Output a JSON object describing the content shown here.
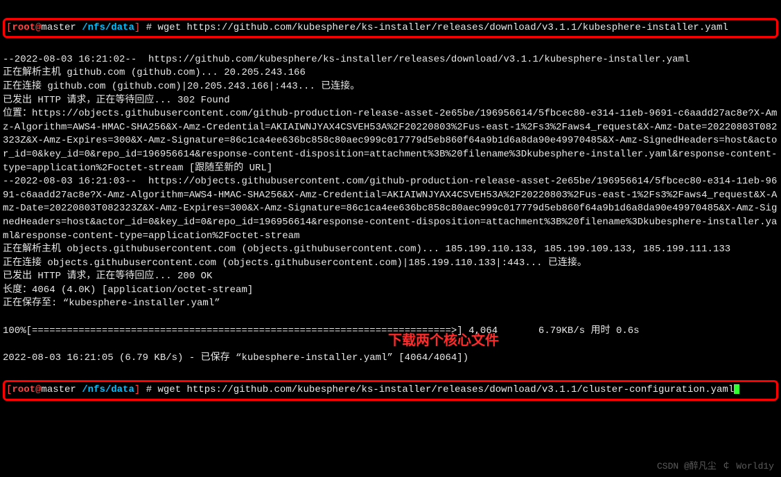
{
  "prompt1": {
    "user": "root",
    "at": "@",
    "host": "master",
    "path": "/nfs/data",
    "hash": "#",
    "command": "wget https://github.com/kubesphere/ks-installer/releases/download/v3.1.1/kubesphere-installer.yaml"
  },
  "output": {
    "l1": "--2022-08-03 16:21:02--  https://github.com/kubesphere/ks-installer/releases/download/v3.1.1/kubesphere-installer.yaml",
    "l2": "正在解析主机 github.com (github.com)... 20.205.243.166",
    "l3": "正在连接 github.com (github.com)|20.205.243.166|:443... 已连接。",
    "l4": "已发出 HTTP 请求，正在等待回应... 302 Found",
    "l5": "位置：https://objects.githubusercontent.com/github-production-release-asset-2e65be/196956614/5fbcec80-e314-11eb-9691-c6aadd27ac8e?X-Amz-Algorithm=AWS4-HMAC-SHA256&X-Amz-Credential=AKIAIWNJYAX4CSVEH53A%2F20220803%2Fus-east-1%2Fs3%2Faws4_request&X-Amz-Date=20220803T082323Z&X-Amz-Expires=300&X-Amz-Signature=86c1ca4ee636bc858c80aec999c017779d5eb860f64a9b1d6a8da90e49970485&X-Amz-SignedHeaders=host&actor_id=0&key_id=0&repo_id=196956614&response-content-disposition=attachment%3B%20filename%3Dkubesphere-installer.yaml&response-content-type=application%2Foctet-stream [跟随至新的 URL]",
    "l6": "--2022-08-03 16:21:03--  https://objects.githubusercontent.com/github-production-release-asset-2e65be/196956614/5fbcec80-e314-11eb-9691-c6aadd27ac8e?X-Amz-Algorithm=AWS4-HMAC-SHA256&X-Amz-Credential=AKIAIWNJYAX4CSVEH53A%2F20220803%2Fus-east-1%2Fs3%2Faws4_request&X-Amz-Date=20220803T082323Z&X-Amz-Expires=300&X-Amz-Signature=86c1ca4ee636bc858c80aec999c017779d5eb860f64a9b1d6a8da90e49970485&X-Amz-SignedHeaders=host&actor_id=0&key_id=0&repo_id=196956614&response-content-disposition=attachment%3B%20filename%3Dkubesphere-installer.yaml&response-content-type=application%2Foctet-stream",
    "l7": "正在解析主机 objects.githubusercontent.com (objects.githubusercontent.com)... 185.199.110.133, 185.199.109.133, 185.199.111.133",
    "l8": "正在连接 objects.githubusercontent.com (objects.githubusercontent.com)|185.199.110.133|:443... 已连接。",
    "l9": "已发出 HTTP 请求，正在等待回应... 200 OK",
    "l10": "长度：4064 (4.0K) [application/octet-stream]",
    "l11": "正在保存至: “kubesphere-installer.yaml”",
    "l12": "",
    "l13": "100%[========================================================================>] 4,064       6.79KB/s 用时 0.6s",
    "l14": "",
    "l15": "2022-08-03 16:21:05 (6.79 KB/s) - 已保存 “kubesphere-installer.yaml” [4064/4064])",
    "l16": ""
  },
  "annotation": "下载两个核心文件",
  "prompt2": {
    "user": "root",
    "at": "@",
    "host": "master",
    "path": "/nfs/data",
    "hash": "#",
    "command": "wget https://github.com/kubesphere/ks-installer/releases/download/v3.1.1/cluster-configuration.yaml"
  },
  "watermark": "CSDN @醉凡尘 ￠ World1y"
}
